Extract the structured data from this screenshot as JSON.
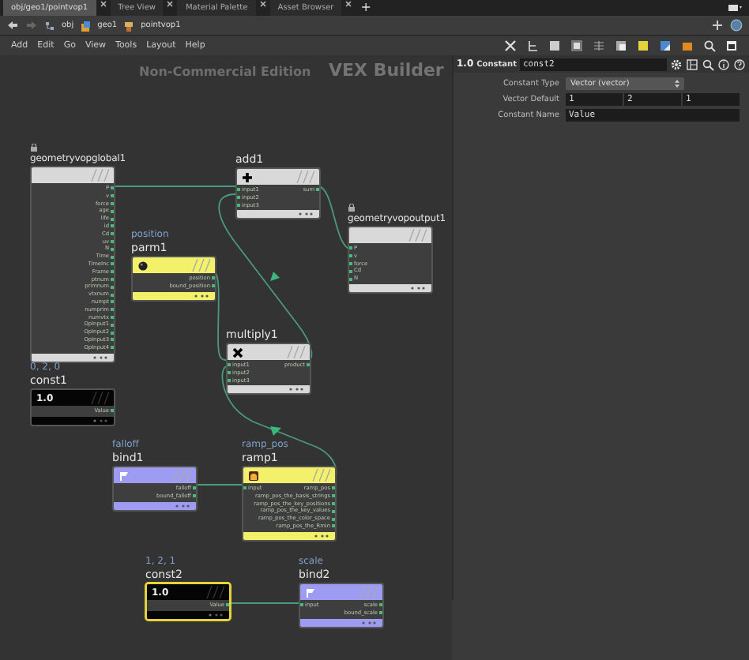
{
  "tabs": [
    {
      "label": "obj/geo1/pointvop1",
      "selected": true
    },
    {
      "label": "Tree View",
      "selected": false
    },
    {
      "label": "Material Palette",
      "selected": false
    },
    {
      "label": "Asset Browser",
      "selected": false
    }
  ],
  "new_tab": "+",
  "path": [
    "obj",
    "geo1",
    "pointvop1"
  ],
  "menu": [
    "Add",
    "Edit",
    "Go",
    "View",
    "Tools",
    "Layout",
    "Help"
  ],
  "network": {
    "edition": "Non-Commercial Edition",
    "context": "VEX Builder",
    "nodes": [
      {
        "name": "geometryvopglobal1",
        "kind": "global",
        "locked": true,
        "selected": false,
        "outputs": [
          "P",
          "v",
          "force",
          "age",
          "life",
          "id",
          "Cd",
          "uv",
          "N",
          "Time",
          "TimeInc",
          "Frame",
          "ptnum",
          "primnum",
          "vtxnum",
          "numpt",
          "numprim",
          "numvtx",
          "OpInput1",
          "OpInput2",
          "OpInput3",
          "OpInput4"
        ]
      },
      {
        "name": "add1",
        "kind": "add",
        "locked": false,
        "selected": false,
        "inputs": [
          "input1",
          "input2",
          "input3"
        ],
        "outputs": [
          "sum"
        ]
      },
      {
        "name": "parm1",
        "caption": "position",
        "kind": "parm",
        "locked": false,
        "selected": false,
        "outputs": [
          "position",
          "bound_position"
        ]
      },
      {
        "name": "geometryvopoutput1",
        "kind": "output",
        "locked": true,
        "selected": false,
        "inputs": [
          "P",
          "v",
          "force",
          "Cd",
          "N"
        ]
      },
      {
        "name": "multiply1",
        "kind": "multiply",
        "locked": false,
        "selected": false,
        "inputs": [
          "input1",
          "input2",
          "input3"
        ],
        "outputs": [
          "product"
        ]
      },
      {
        "name": "const1",
        "caption": "0, 2, 0",
        "kind": "const",
        "icon_text": "1.0",
        "locked": false,
        "selected": false,
        "outputs": [
          "Value"
        ]
      },
      {
        "name": "bind1",
        "caption": "falloff",
        "kind": "bind",
        "locked": false,
        "selected": false,
        "outputs": [
          "falloff",
          "bound_falloff"
        ]
      },
      {
        "name": "ramp1",
        "caption": "ramp_pos",
        "kind": "ramp",
        "locked": false,
        "selected": false,
        "inputs": [
          "input"
        ],
        "outputs": [
          "ramp_pos",
          "ramp_pos_the_basis_strings",
          "ramp_pos_the_key_positions",
          "ramp_pos_the_key_values",
          "ramp_pos_the_color_space",
          "ramp_pos_the_Rmin"
        ]
      },
      {
        "name": "const2",
        "caption": "1, 2, 1",
        "kind": "const",
        "icon_text": "1.0",
        "locked": false,
        "selected": true,
        "outputs": [
          "Value"
        ]
      },
      {
        "name": "bind2",
        "caption": "scale",
        "kind": "bind",
        "locked": false,
        "selected": false,
        "inputs": [
          "input"
        ],
        "outputs": [
          "scale",
          "bound_scale"
        ]
      }
    ]
  },
  "parameters": {
    "icon_text": "1.0",
    "type_label": "Constant",
    "name": "const2",
    "rows": [
      {
        "kind": "menu",
        "label": "Constant Type",
        "value": "Vector (vector)"
      },
      {
        "kind": "vector",
        "label": "Vector Default",
        "values": [
          "1",
          "2",
          "1"
        ]
      },
      {
        "kind": "text",
        "label": "Constant Name",
        "value": "Value"
      }
    ]
  }
}
